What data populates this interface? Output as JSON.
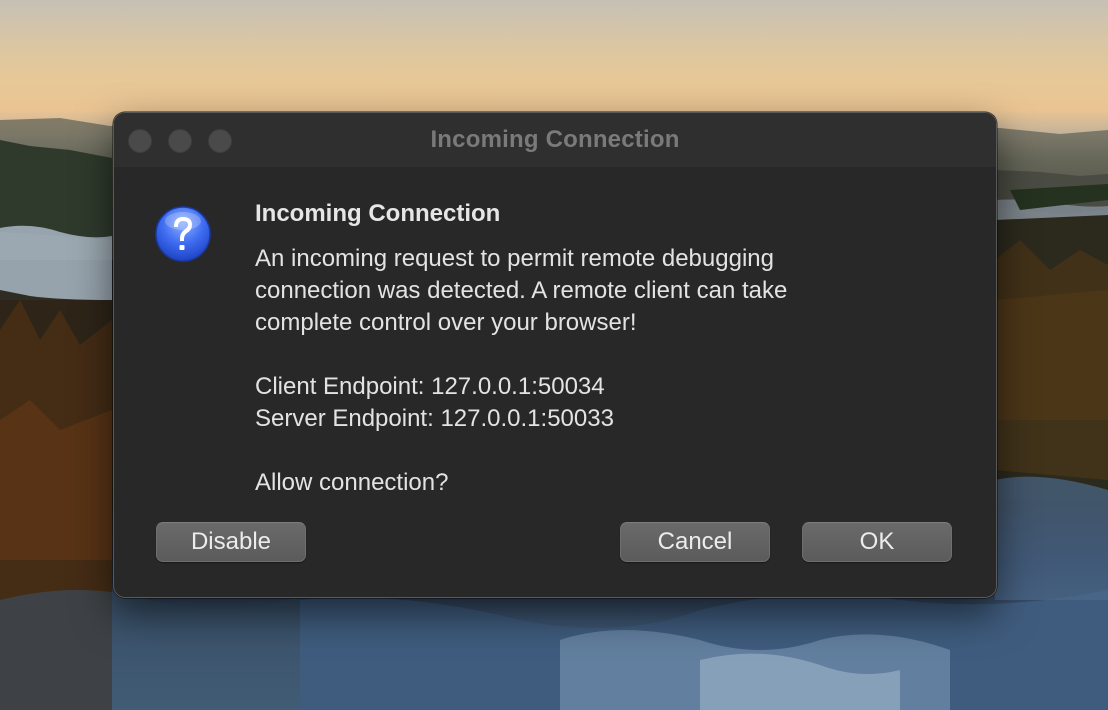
{
  "window": {
    "title": "Incoming Connection",
    "icon": "question-mark-icon"
  },
  "dialog": {
    "heading": "Incoming Connection",
    "message_lines": [
      "An incoming request to permit remote debugging",
      "connection was detected. A remote client can take",
      "complete control over your browser!"
    ],
    "client_endpoint": "Client Endpoint: 127.0.0.1:50034",
    "server_endpoint": "Server Endpoint: 127.0.0.1:50033",
    "prompt": "Allow connection?"
  },
  "buttons": {
    "disable": "Disable",
    "cancel": "Cancel",
    "ok": "OK"
  },
  "colors": {
    "dialog_background": "#282828",
    "button_background": "#5f5f5f",
    "icon_blue": "#2f5fe0"
  }
}
